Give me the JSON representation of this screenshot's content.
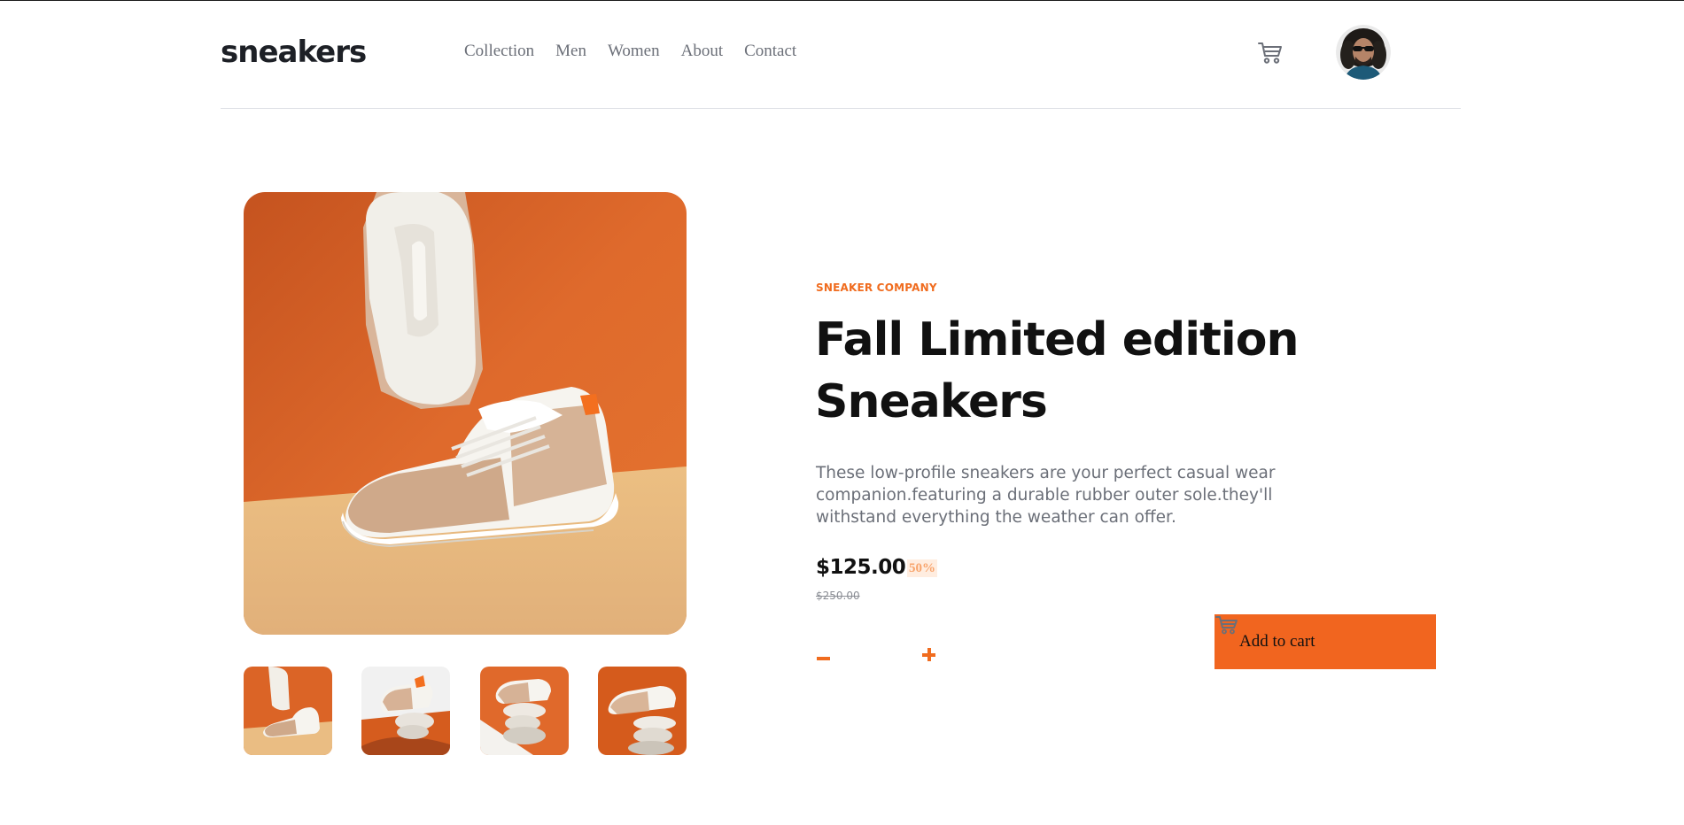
{
  "header": {
    "logo": "sneakers",
    "nav": [
      "Collection",
      "Men",
      "Women",
      "About",
      "Contact"
    ],
    "cart_icon": "cart-icon",
    "avatar_icon": "user-avatar"
  },
  "gallery": {
    "main_image": "sneaker-product-photo",
    "thumbnails": [
      "thumbnail-1",
      "thumbnail-2",
      "thumbnail-3",
      "thumbnail-4"
    ]
  },
  "product": {
    "company": "SNEAKER COMPANY",
    "title": "Fall Limited edition Sneakers",
    "description": "These low-profile sneakers are your perfect casual wear companion.featuring a durable rubber outer sole.they'll withstand everything the weather can offer.",
    "price": "$125.00",
    "discount": "50%",
    "old_price": "$250.00",
    "quantity": ""
  },
  "actions": {
    "add_to_cart": "Add to cart"
  },
  "colors": {
    "accent": "#f1651f",
    "accent_light": "#ffede0",
    "dark": "#1d2026",
    "gray": "#6b6f78"
  }
}
